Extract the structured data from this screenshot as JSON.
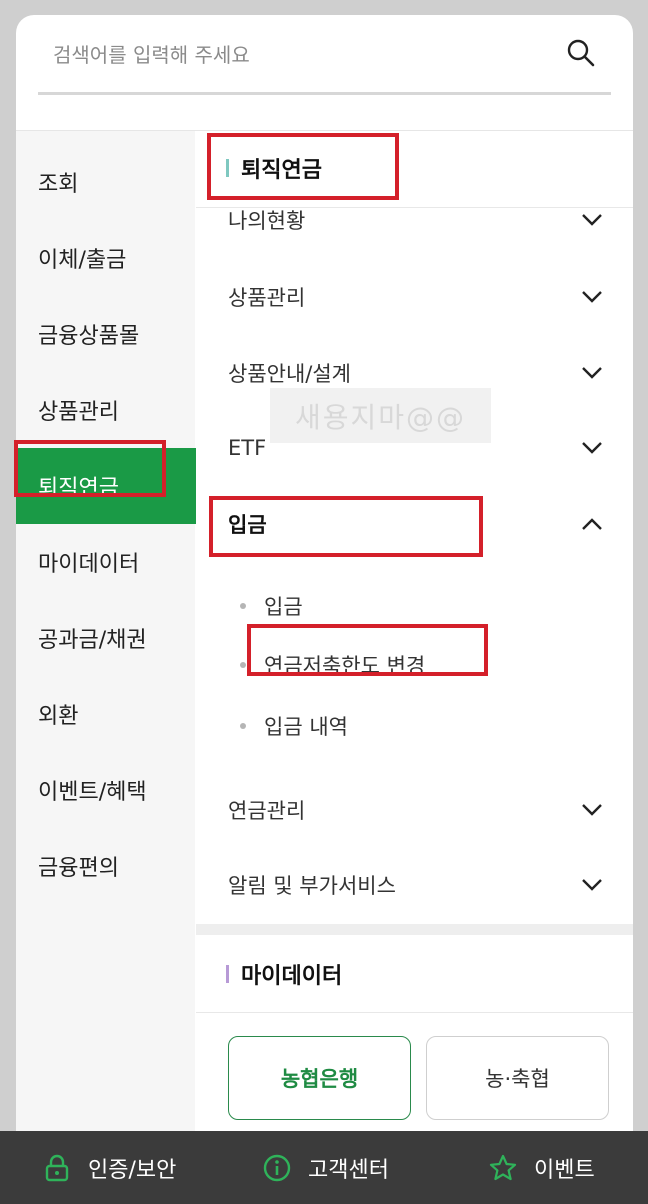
{
  "search": {
    "placeholder": "검색어를 입력해 주세요"
  },
  "sidebar": {
    "items": [
      {
        "label": "조회"
      },
      {
        "label": "이체/출금"
      },
      {
        "label": "금융상품몰"
      },
      {
        "label": "상품관리"
      },
      {
        "label": "퇴직연금",
        "active": true
      },
      {
        "label": "마이데이터"
      },
      {
        "label": "공과금/채권"
      },
      {
        "label": "외환"
      },
      {
        "label": "이벤트/혜택"
      },
      {
        "label": "금융편의"
      }
    ]
  },
  "content": {
    "section1": {
      "title": "퇴직연금",
      "bar_color": "#7fc8c0",
      "menus": [
        {
          "label": "나의현황"
        },
        {
          "label": "상품관리"
        },
        {
          "label": "상품안내/설계"
        },
        {
          "label": "ETF"
        },
        {
          "label": "입금",
          "expanded": true
        }
      ],
      "sub_items": [
        {
          "label": "입금"
        },
        {
          "label": "연금저축한도 변경"
        },
        {
          "label": "입금 내역"
        }
      ],
      "menus_after": [
        {
          "label": "연금관리"
        },
        {
          "label": "알림 및 부가서비스"
        }
      ]
    },
    "section2": {
      "title": "마이데이터",
      "bar_color": "#b79ad6",
      "buttons": [
        {
          "label": "농협은행"
        },
        {
          "label": "농·축협"
        }
      ]
    },
    "watermark": "새용지마@@"
  },
  "bottom_bar": {
    "items": [
      {
        "label": "인증/보안",
        "icon": "lock-icon"
      },
      {
        "label": "고객센터",
        "icon": "info-icon"
      },
      {
        "label": "이벤트",
        "icon": "star-icon"
      }
    ],
    "icon_color": "#2fb35a"
  },
  "colors": {
    "accent": "#1a9a46",
    "highlight": "#d4202a"
  }
}
